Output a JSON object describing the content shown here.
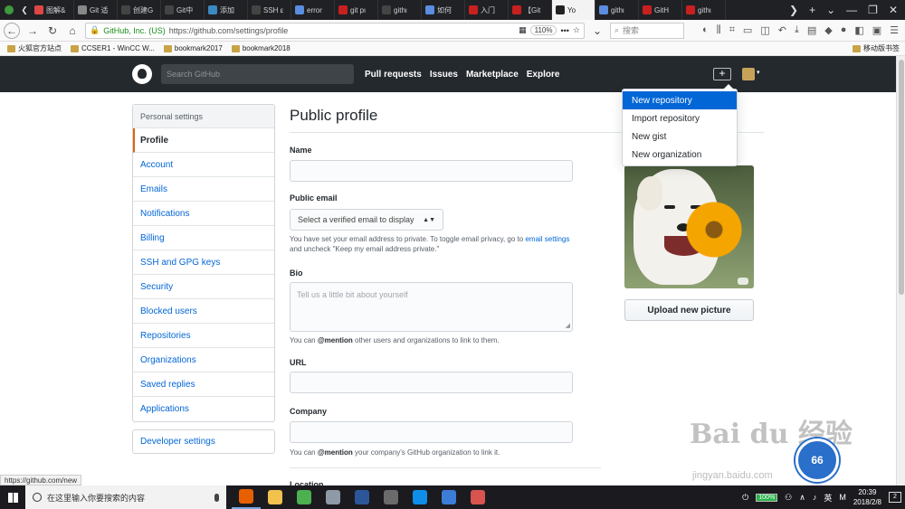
{
  "browser": {
    "tabs": [
      {
        "label": "图解&",
        "icon_color": "#e04646"
      },
      {
        "label": "Git 适",
        "icon_color": "#888888"
      },
      {
        "label": "创建G",
        "icon_color": "#444444"
      },
      {
        "label": "Git中",
        "icon_color": "#444444"
      },
      {
        "label": "添加",
        "icon_color": "#3b88c3"
      },
      {
        "label": "SSH ε",
        "icon_color": "#444444"
      },
      {
        "label": "error",
        "icon_color": "#5b8de0"
      },
      {
        "label": "git pι",
        "icon_color": "#c82020"
      },
      {
        "label": "githι",
        "icon_color": "#444444"
      },
      {
        "label": "如何",
        "icon_color": "#5b8de0"
      },
      {
        "label": "入门",
        "icon_color": "#c82020"
      },
      {
        "label": "【Git",
        "icon_color": "#c82020"
      },
      {
        "label": "Yo",
        "icon_color": "#222222",
        "active": true
      },
      {
        "label": "githι",
        "icon_color": "#5b8de0"
      },
      {
        "label": "GitH",
        "icon_color": "#c82020"
      },
      {
        "label": "githι",
        "icon_color": "#c82020"
      }
    ],
    "new_tab": "+",
    "tab_menu": "⌄",
    "site_identity": "GitHub, Inc. (US)",
    "url": "https://github.com/settings/profile",
    "zoom": "110%",
    "search_placeholder": "搜索",
    "bookmarks": [
      "火狐官方站点",
      "CCSER1 - WinCC W...",
      "bookmark2017",
      "bookmark2018"
    ],
    "mobile_bookmarks": "移动版书签",
    "status_url": "https://github.com/new"
  },
  "github_header": {
    "search_placeholder": "Search GitHub",
    "nav": [
      "Pull requests",
      "Issues",
      "Marketplace",
      "Explore"
    ],
    "plus_label": "+"
  },
  "dropdown": {
    "items": [
      "New repository",
      "Import repository",
      "New gist",
      "New organization"
    ]
  },
  "sidebar": {
    "header": "Personal settings",
    "items": [
      "Profile",
      "Account",
      "Emails",
      "Notifications",
      "Billing",
      "SSH and GPG keys",
      "Security",
      "Blocked users",
      "Repositories",
      "Organizations",
      "Saved replies",
      "Applications"
    ],
    "selected_index": 0,
    "developer_settings": "Developer settings"
  },
  "profile": {
    "title": "Public profile",
    "name_label": "Name",
    "name_value": "",
    "email_label": "Public email",
    "email_select": "Select a verified email to display",
    "email_note_pre": "You have set your email address to private. To toggle email privacy, go to",
    "email_note_link": "email settings",
    "email_note_post": "and uncheck \"Keep my email address private.\"",
    "bio_label": "Bio",
    "bio_placeholder": "Tell us a little bit about yourself",
    "bio_note_pre": "You can",
    "bio_note_mention": "@mention",
    "bio_note_post": "other users and organizations to link to them.",
    "url_label": "URL",
    "url_value": "",
    "company_label": "Company",
    "company_value": "",
    "company_note_pre": "You can",
    "company_note_mention": "@mention",
    "company_note_post": "your company's GitHub organization to link it.",
    "location_label": "Location",
    "upload_button": "Upload new picture"
  },
  "watermark": {
    "main": "Bai du 经验",
    "sub": "jingyan.baidu.com",
    "badge": "66"
  },
  "taskbar": {
    "search_placeholder": "在这里输入你要搜索的内容",
    "apps": [
      {
        "name": "firefox",
        "color": "#e66000",
        "open": true
      },
      {
        "name": "explorer",
        "color": "#f2c14e",
        "open": false
      },
      {
        "name": "app-green",
        "color": "#4caf50",
        "open": false
      },
      {
        "name": "app-gray",
        "color": "#8e9aa5",
        "open": false
      },
      {
        "name": "word",
        "color": "#2b579a",
        "open": false
      },
      {
        "name": "photo",
        "color": "#6b6b6b",
        "open": false
      },
      {
        "name": "teamviewer",
        "color": "#0e8ee9",
        "open": false
      },
      {
        "name": "app-blue",
        "color": "#3c7dd9",
        "open": false
      },
      {
        "name": "app-color",
        "color": "#d9534f",
        "open": false
      }
    ],
    "battery": "100%",
    "ime": "英",
    "ime2": "M",
    "time": "20:39",
    "date": "2018/2/8",
    "notify": "2"
  }
}
